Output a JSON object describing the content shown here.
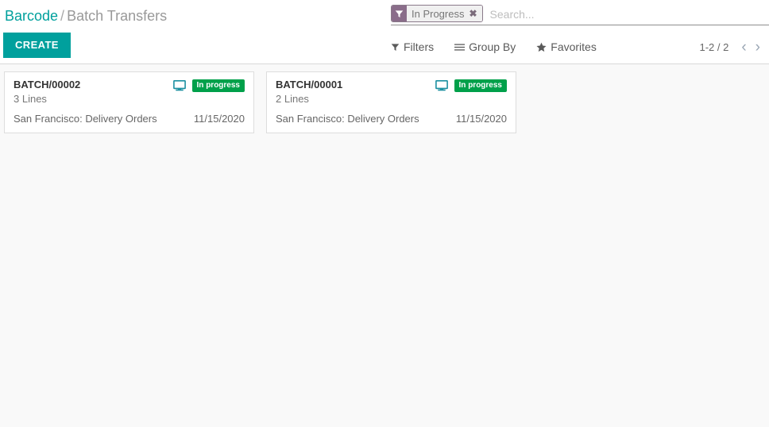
{
  "breadcrumb": {
    "root": "Barcode",
    "separator": "/",
    "current": "Batch Transfers"
  },
  "actions": {
    "create_label": "CREATE"
  },
  "search": {
    "facet_label": "In Progress",
    "facet_icon": "filter-icon",
    "facet_close": "✖",
    "placeholder": "Search...",
    "value": ""
  },
  "toolbar": {
    "items": [
      {
        "label": "Filters",
        "icon": "filter-icon"
      },
      {
        "label": "Group By",
        "icon": "list-icon"
      },
      {
        "label": "Favorites",
        "icon": "star-icon"
      }
    ]
  },
  "pager": {
    "count": "1-2 / 2",
    "previous": "‹",
    "next": "›"
  },
  "colors": {
    "accent": "#00a09d",
    "badge_green": "#00a04a",
    "facet_purple": "#8a6d8a",
    "monitor_teal": "#1a8fa0",
    "panel_bg": "#ffffff",
    "content_bg": "#f9f9f9"
  },
  "cards": [
    {
      "name": "BATCH/00002",
      "lines": "3 Lines",
      "state": "In progress",
      "origin": "San Francisco: Delivery Orders",
      "date": "11/15/2020",
      "device_icon": "monitor-icon"
    },
    {
      "name": "BATCH/00001",
      "lines": "2 Lines",
      "state": "In progress",
      "origin": "San Francisco: Delivery Orders",
      "date": "11/15/2020",
      "device_icon": "monitor-icon"
    }
  ]
}
